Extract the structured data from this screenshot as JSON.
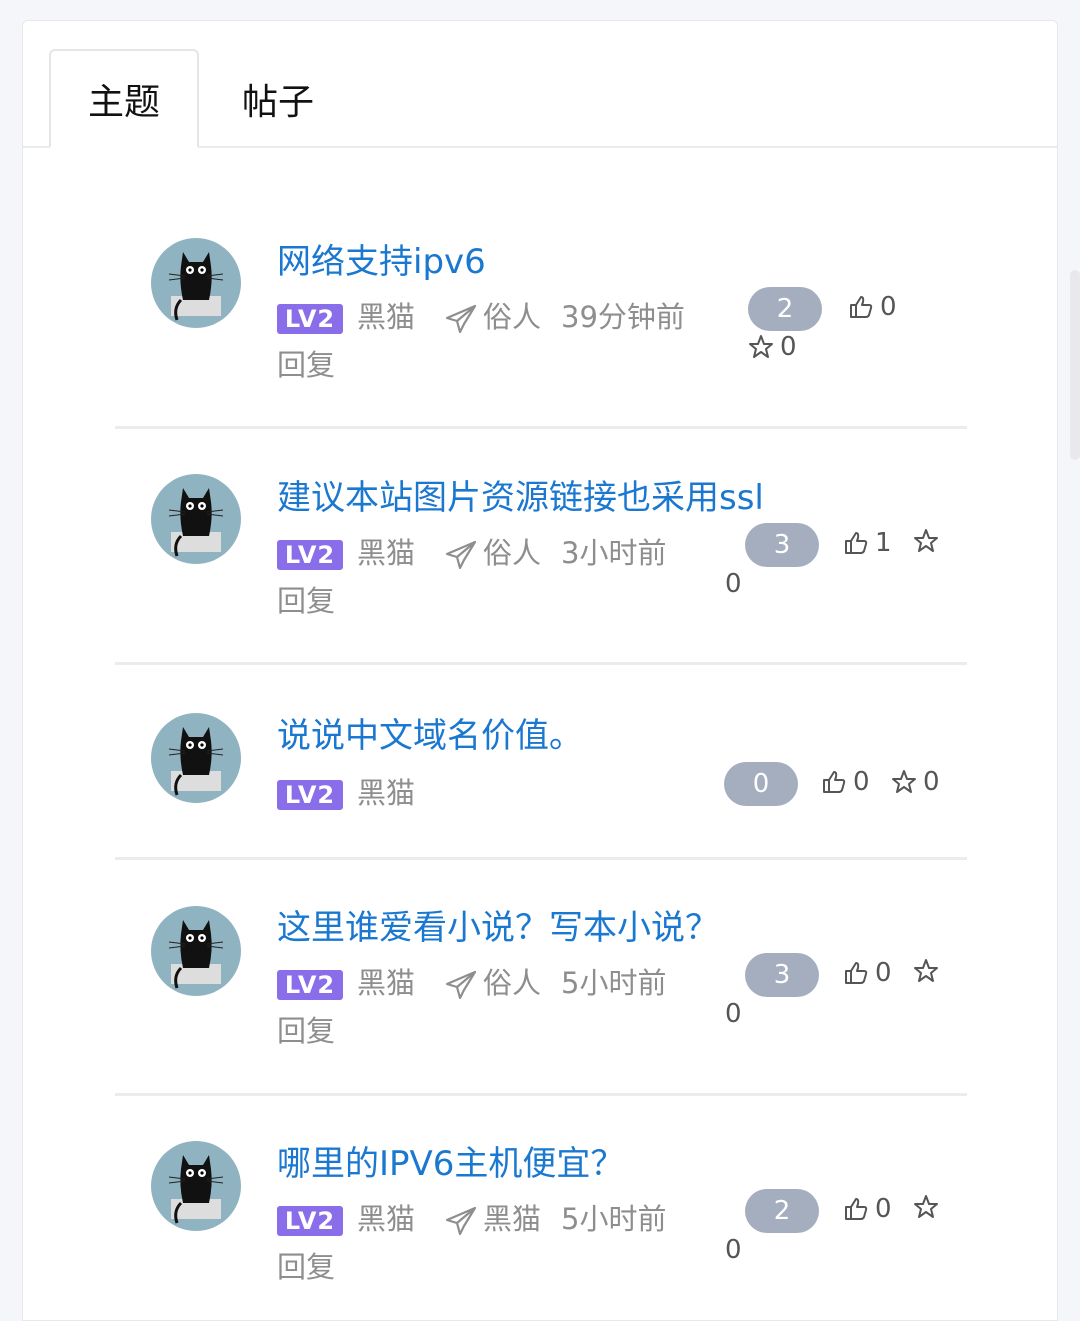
{
  "tabs": [
    {
      "label": "主题",
      "active": true
    },
    {
      "label": "帖子",
      "active": false
    }
  ],
  "level_badge": "LV2",
  "topics": [
    {
      "title": "网络支持ipv6",
      "author": "黑猫",
      "last_reply_user": "俗人",
      "time": "39分钟前",
      "reply_label": "回复",
      "replies": "2",
      "likes": "0",
      "favorites": "0"
    },
    {
      "title": "建议本站图片资源链接也采用ssl",
      "author": "黑猫",
      "last_reply_user": "俗人",
      "time": "3小时前",
      "reply_label": "回复",
      "replies": "3",
      "likes": "1",
      "favorites": "0"
    },
    {
      "title": "说说中文域名价值。",
      "author": "黑猫",
      "last_reply_user": "",
      "time": "",
      "reply_label": "",
      "replies": "0",
      "likes": "0",
      "favorites": "0"
    },
    {
      "title": "这里谁爱看小说？写本小说？",
      "author": "黑猫",
      "last_reply_user": "俗人",
      "time": "5小时前",
      "reply_label": "回复",
      "replies": "3",
      "likes": "0",
      "favorites": "0"
    },
    {
      "title": "哪里的IPV6主机便宜？",
      "author": "黑猫",
      "last_reply_user": "黑猫",
      "time": "5小时前",
      "reply_label": "回复",
      "replies": "2",
      "likes": "0",
      "favorites": "0"
    }
  ],
  "colors": {
    "link": "#1b78d0",
    "badge": "#a5aebf",
    "level": "#8a6de9",
    "avatar_bg": "#8fb3c0"
  }
}
